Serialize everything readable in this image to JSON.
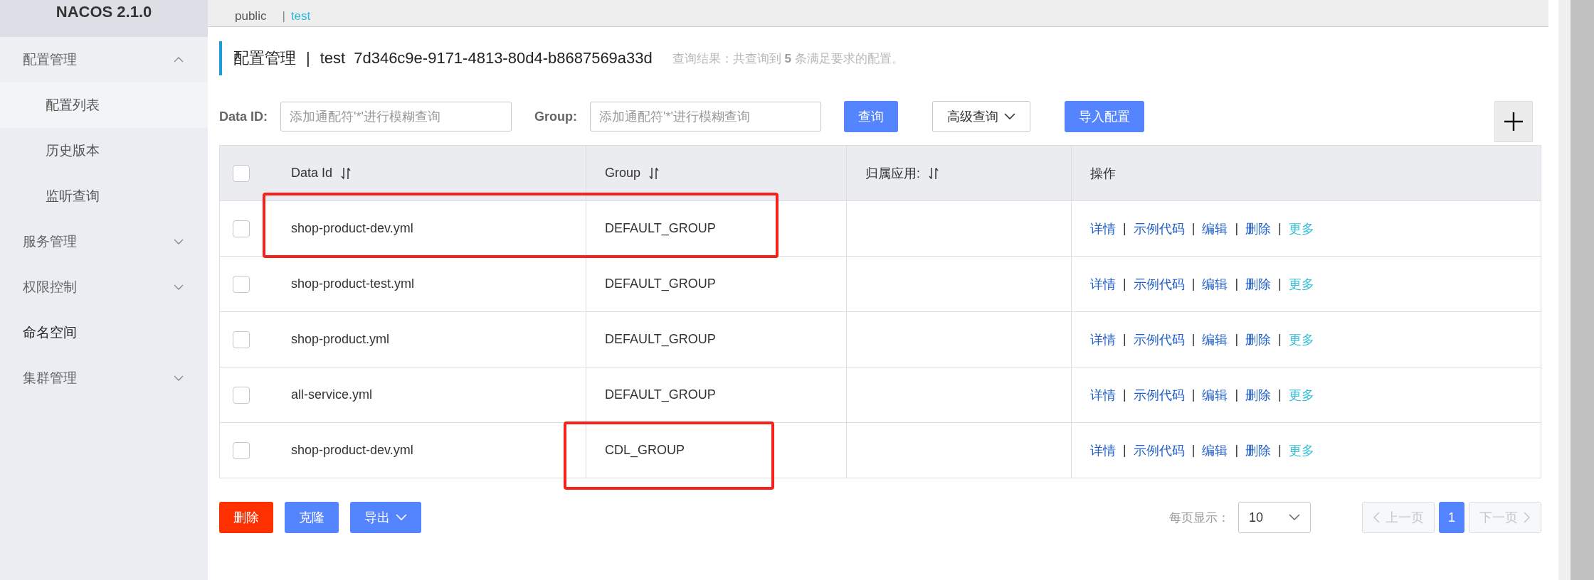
{
  "logo": "NACOS 2.1.0",
  "sidebar": {
    "items": [
      {
        "label": "配置管理",
        "kind": "group",
        "expanded": true,
        "children": [
          {
            "label": "配置列表",
            "selected": true
          },
          {
            "label": "历史版本",
            "selected": false
          },
          {
            "label": "监听查询",
            "selected": false
          }
        ]
      },
      {
        "label": "服务管理",
        "kind": "group",
        "expanded": false
      },
      {
        "label": "权限控制",
        "kind": "group",
        "expanded": false
      },
      {
        "label": "命名空间",
        "kind": "link"
      },
      {
        "label": "集群管理",
        "kind": "group",
        "expanded": false
      }
    ]
  },
  "namespace_bar": {
    "separator": "|",
    "namespaces": [
      {
        "label": "public",
        "selected": false
      },
      {
        "label": "test",
        "selected": true
      }
    ]
  },
  "heading": {
    "title": "配置管理",
    "separator": "|",
    "namespace": "test",
    "namespace_id": "7d346c9e-9171-4813-80d4-b8687569a33d",
    "summary": "查询结果：共查询到 **5** 条满足要求的配置。"
  },
  "filters": [
    {
      "label": "Data ID:",
      "placeholder": "添加通配符'*'进行模糊查询"
    },
    {
      "label": "Group:",
      "placeholder": "添加通配符'*'进行模糊查询"
    }
  ],
  "filter_buttons": [
    {
      "label": "查询",
      "kind": "primary"
    },
    {
      "label": "高级查询",
      "kind": "dropdown"
    },
    {
      "label": "导入配置",
      "kind": "primary"
    }
  ],
  "table": {
    "select_all": {
      "checked": false
    },
    "separator": "|",
    "columns": [
      {
        "label": "Data Id",
        "sortable": true
      },
      {
        "label": "Group",
        "sortable": true
      },
      {
        "label": "归属应用:",
        "sortable": true
      },
      {
        "label": "操作",
        "sortable": false
      }
    ],
    "rows": [
      {
        "checked": false,
        "data_id": "shop-product-dev.yml",
        "group": "DEFAULT_GROUP",
        "actions": [
          {
            "label": "详情",
            "kind": "link"
          },
          {
            "label": "示例代码",
            "kind": "link"
          },
          {
            "label": "编辑",
            "kind": "link"
          },
          {
            "label": "删除",
            "kind": "link"
          },
          {
            "label": "更多",
            "kind": "more"
          }
        ]
      },
      {
        "checked": false,
        "data_id": "shop-product-test.yml",
        "group": "DEFAULT_GROUP",
        "actions": [
          {
            "label": "详情",
            "kind": "link"
          },
          {
            "label": "示例代码",
            "kind": "link"
          },
          {
            "label": "编辑",
            "kind": "link"
          },
          {
            "label": "删除",
            "kind": "link"
          },
          {
            "label": "更多",
            "kind": "more"
          }
        ]
      },
      {
        "checked": false,
        "data_id": "shop-product.yml",
        "group": "DEFAULT_GROUP",
        "actions": [
          {
            "label": "详情",
            "kind": "link"
          },
          {
            "label": "示例代码",
            "kind": "link"
          },
          {
            "label": "编辑",
            "kind": "link"
          },
          {
            "label": "删除",
            "kind": "link"
          },
          {
            "label": "更多",
            "kind": "more"
          }
        ]
      },
      {
        "checked": false,
        "data_id": "all-service.yml",
        "group": "DEFAULT_GROUP",
        "actions": [
          {
            "label": "详情",
            "kind": "link"
          },
          {
            "label": "示例代码",
            "kind": "link"
          },
          {
            "label": "编辑",
            "kind": "link"
          },
          {
            "label": "删除",
            "kind": "link"
          },
          {
            "label": "更多",
            "kind": "more"
          }
        ]
      },
      {
        "checked": false,
        "data_id": "shop-product-dev.yml",
        "group": "CDL_GROUP",
        "actions": [
          {
            "label": "详情",
            "kind": "link"
          },
          {
            "label": "示例代码",
            "kind": "link"
          },
          {
            "label": "编辑",
            "kind": "link"
          },
          {
            "label": "删除",
            "kind": "link"
          },
          {
            "label": "更多",
            "kind": "more"
          }
        ]
      }
    ]
  },
  "bottom_buttons": [
    {
      "label": "删除",
      "kind": "danger"
    },
    {
      "label": "克隆",
      "kind": "primary"
    },
    {
      "label": "导出",
      "kind": "dropdown"
    }
  ],
  "pagination": {
    "page_size_label": "每页显示：",
    "page_size": "10",
    "prev": {
      "label": "上一页",
      "disabled": true
    },
    "pages": [
      {
        "label": "1",
        "selected": true
      }
    ],
    "next": {
      "label": "下一页",
      "disabled": true
    }
  }
}
